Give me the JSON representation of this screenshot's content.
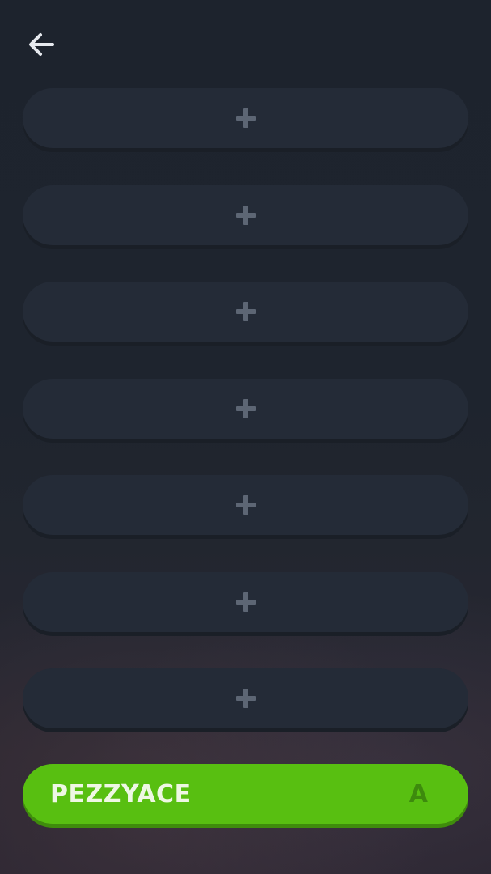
{
  "header": {
    "back_icon": "arrow-left-icon"
  },
  "slots": [
    {
      "icon": "plus-icon"
    },
    {
      "icon": "plus-icon"
    },
    {
      "icon": "plus-icon"
    },
    {
      "icon": "plus-icon"
    },
    {
      "icon": "plus-icon"
    },
    {
      "icon": "plus-icon"
    },
    {
      "icon": "plus-icon"
    }
  ],
  "player": {
    "name": "PEZZYACE",
    "tag": "A",
    "color": "#58bf11"
  },
  "colors": {
    "background": "#1d232d",
    "slot": "#242b37",
    "plus": "#5d6674",
    "accent": "#58bf11"
  }
}
